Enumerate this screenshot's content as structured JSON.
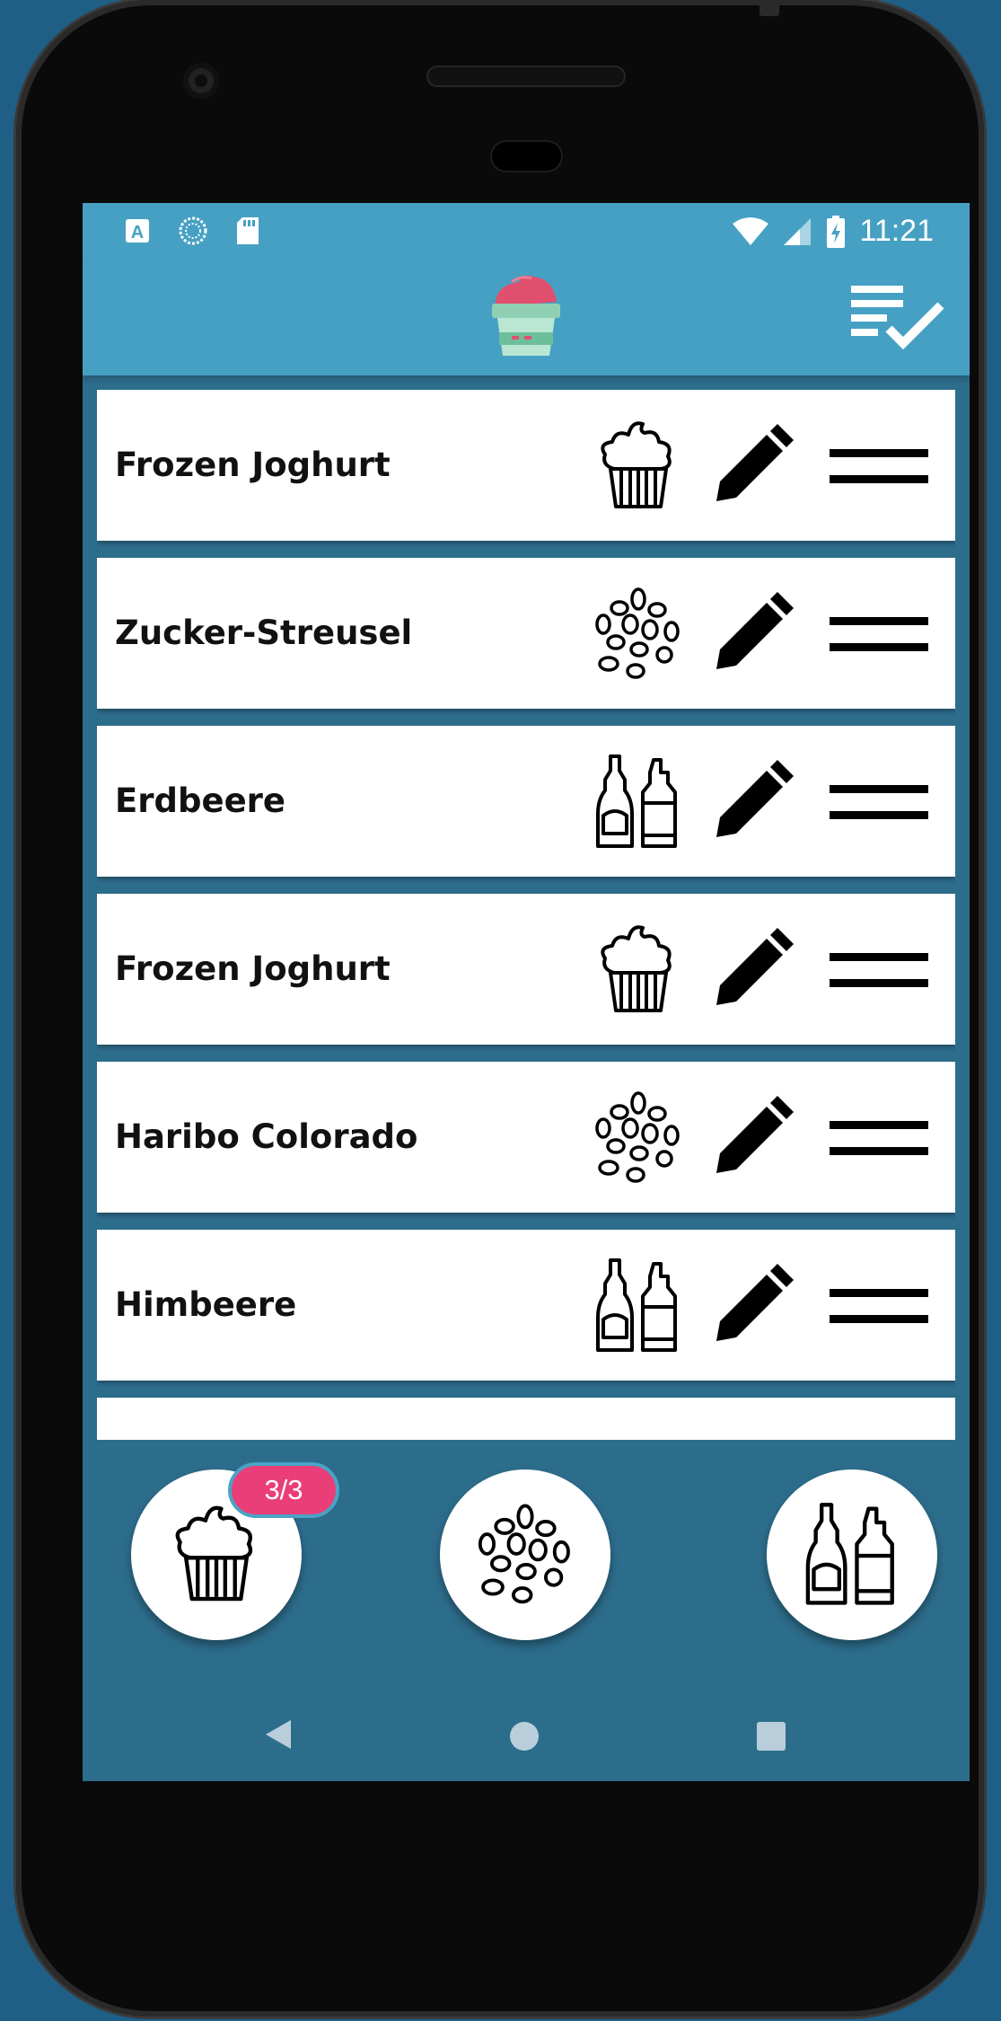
{
  "status_bar": {
    "time": "11:21",
    "icons": [
      "a-app-icon",
      "loading-icon",
      "sdcard-icon",
      "wifi-icon",
      "signal-icon",
      "battery-charging-icon"
    ]
  },
  "app_bar": {
    "logo_icon": "frozen-yoghurt-cup-icon",
    "action_icon": "checklist-icon"
  },
  "list": {
    "items": [
      {
        "label": "Frozen Joghurt",
        "category_icon": "cupcake-icon"
      },
      {
        "label": "Zucker-Streusel",
        "category_icon": "sprinkles-icon"
      },
      {
        "label": "Erdbeere",
        "category_icon": "sauce-bottles-icon"
      },
      {
        "label": "Frozen Joghurt",
        "category_icon": "cupcake-icon"
      },
      {
        "label": "Haribo Colorado",
        "category_icon": "sprinkles-icon"
      },
      {
        "label": "Himbeere",
        "category_icon": "sauce-bottles-icon"
      }
    ]
  },
  "bottom_actions": {
    "badge": "3/3",
    "buttons": [
      "cupcake-icon",
      "sprinkles-icon",
      "sauce-bottles-icon"
    ]
  },
  "colors": {
    "appbar": "#46a0c3",
    "background": "#2d6d8c",
    "badge": "#ea3e78"
  }
}
